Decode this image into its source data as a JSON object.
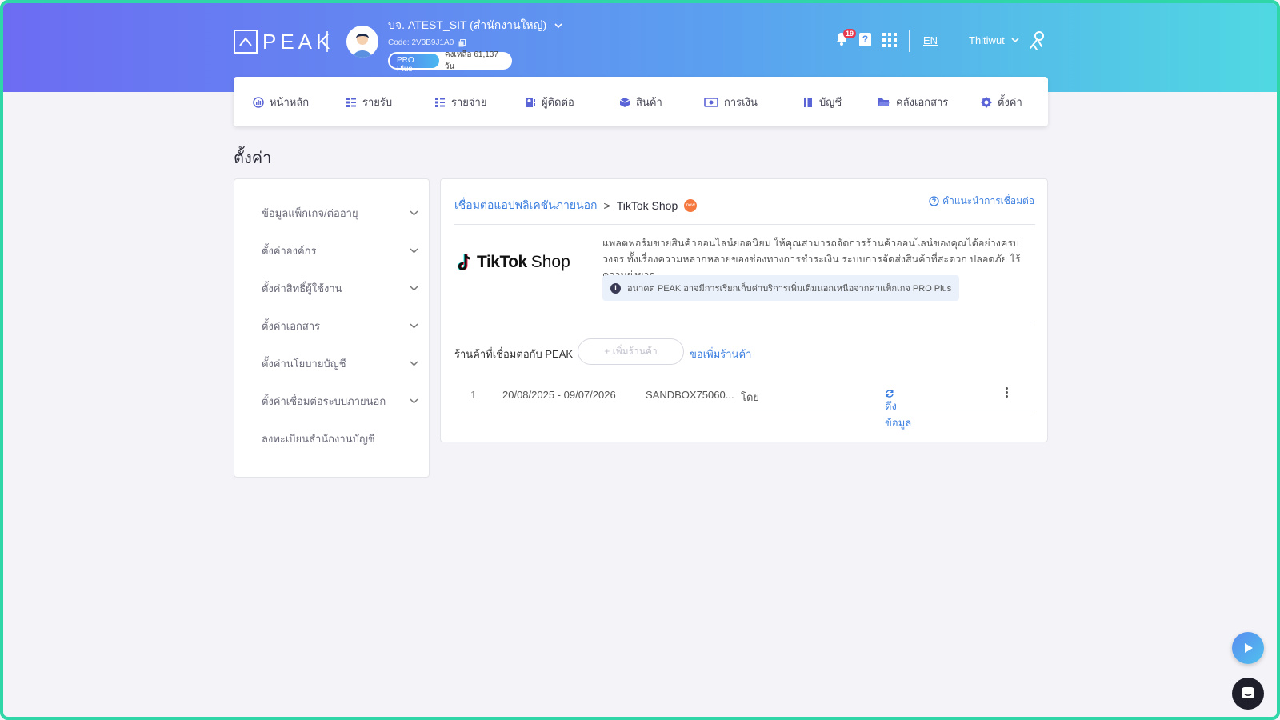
{
  "header": {
    "logo_text": "PEAK",
    "company_name": "บจ. ATEST_SIT (สำนักงานใหญ่)",
    "company_code": "Code: 2V3B9J1A0",
    "plan_badge": "PRO Plus",
    "plan_remaining": "คงเหลือ 61,137 วัน",
    "notification_count": "19",
    "help_label": "?",
    "language": "EN",
    "user_name": "Thitiwut",
    "colors": {
      "gradient_start": "#6c6cf2",
      "gradient_end": "#4fd9e2"
    }
  },
  "nav": {
    "items": [
      {
        "label": "หน้าหลัก",
        "icon": "dashboard-icon"
      },
      {
        "label": "รายรับ",
        "icon": "list-icon"
      },
      {
        "label": "รายจ่าย",
        "icon": "list-icon"
      },
      {
        "label": "ผู้ติดต่อ",
        "icon": "contacts-icon"
      },
      {
        "label": "สินค้า",
        "icon": "box-icon"
      },
      {
        "label": "การเงิน",
        "icon": "money-icon"
      },
      {
        "label": "บัญชี",
        "icon": "book-icon"
      },
      {
        "label": "คลังเอกสาร",
        "icon": "folder-icon"
      },
      {
        "label": "ตั้งค่า",
        "icon": "gear-icon"
      }
    ]
  },
  "page": {
    "title": "ตั้งค่า"
  },
  "sidebar": {
    "items": [
      {
        "label": "ข้อมูลแพ็กเกจ/ต่ออายุ"
      },
      {
        "label": "ตั้งค่าองค์กร"
      },
      {
        "label": "ตั้งค่าสิทธิ์ผู้ใช้งาน"
      },
      {
        "label": "ตั้งค่าเอกสาร"
      },
      {
        "label": "ตั้งค่านโยบายบัญชี"
      },
      {
        "label": "ตั้งค่าเชื่อมต่อระบบภายนอก"
      },
      {
        "label": "ลงทะเบียนสำนักงานบัญชี"
      }
    ]
  },
  "main": {
    "breadcrumb_parent": "เชื่อมต่อแอปพลิเคชันภายนอก",
    "breadcrumb_sep": ">",
    "breadcrumb_current": "TikTok Shop",
    "new_badge": "new",
    "guide_link": "คำแนะนำการเชื่อมต่อ",
    "tiktok_brand": "TikTok",
    "tiktok_shop": "Shop",
    "description": "แพลตฟอร์มขายสินค้าออนไลน์ยอดนิยม ให้คุณสามารถจัดการร้านค้าออนไลน์ของคุณได้อย่างครบวงจร ทั้งเรื่องความหลากหลายของช่องทางการชำระเงิน ระบบการจัดส่งสินค้าที่สะดวก ปลอดภัย ไร้ความยุ่งยาก",
    "info_note": "อนาคต PEAK อาจมีการเรียกเก็บค่าบริการเพิ่มเติมนอกเหนือจากค่าแพ็กเกจ PRO Plus",
    "shops_label": "ร้านค้าที่เชื่อมต่อกับ PEAK",
    "add_shop_button": "+ เพิ่มร้านค้า",
    "request_shop_link": "ขอเพิ่มร้านค้า",
    "rows": [
      {
        "index": "1",
        "period": "20/08/2025 - 09/07/2026",
        "shop": "SANDBOX75060...",
        "by": "โดย",
        "fetch_label": "ดึงข้อมูล"
      }
    ]
  }
}
